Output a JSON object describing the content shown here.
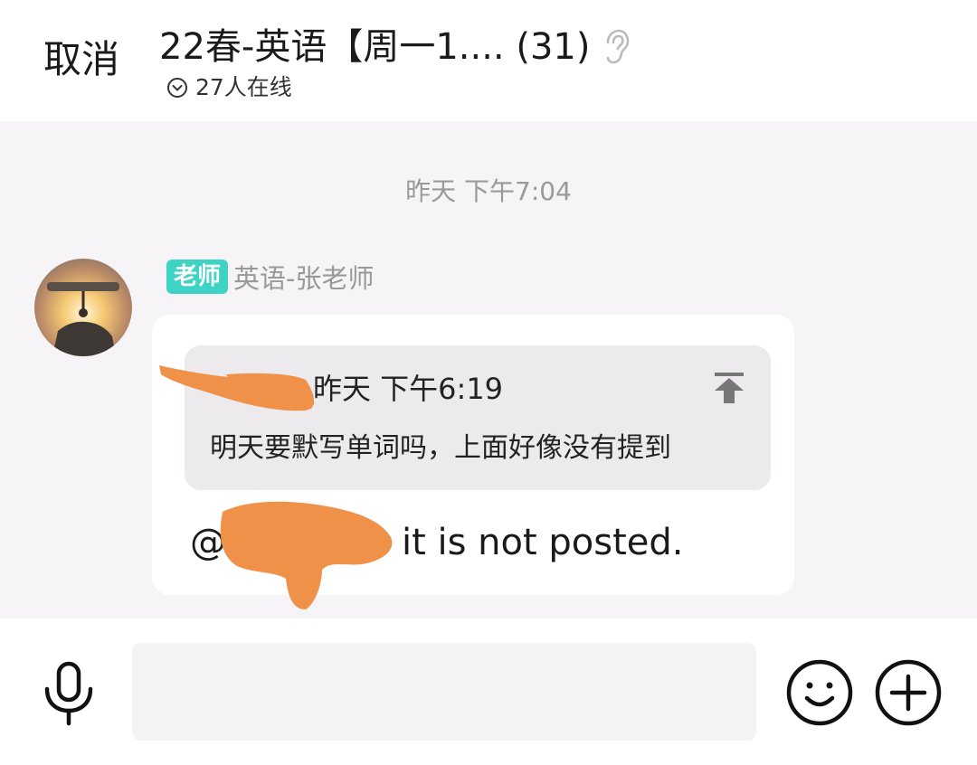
{
  "header": {
    "cancel_label": "取消",
    "title": "22春-英语【周一1.... (31)",
    "online_count": "27人在线"
  },
  "chat": {
    "timestamp": "昨天 下午7:04",
    "message": {
      "role_badge": "老师",
      "sender_name": "英语-张老师",
      "quote": {
        "time": "昨天 下午6:19",
        "text": "明天要默写单词吗，上面好像没有提到"
      },
      "text_prefix": "@",
      "text_body": "it is not posted."
    }
  },
  "input_bar": {
    "placeholder": ""
  },
  "colors": {
    "role_badge": "#3fd3c6",
    "redaction": "#f0914a"
  },
  "icons": [
    "ear-icon",
    "chevron-down-circle-icon",
    "pin-top-icon",
    "microphone-icon",
    "emoji-icon",
    "plus-circle-icon"
  ]
}
